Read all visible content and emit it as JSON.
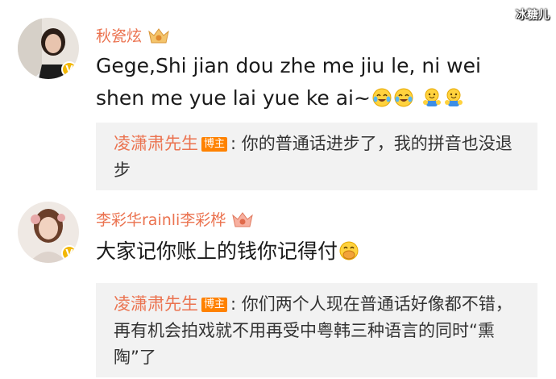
{
  "watermark": "冰糖儿",
  "comments": [
    {
      "username": "秋瓷炫",
      "text": "Gege,Shi jian dou zhe me jiu le, ni wei shen me yue lai yue ke ai~",
      "emojis": [
        "laugh-cry-emoji",
        "laugh-cry-emoji",
        "hug-emoji",
        "hug-emoji"
      ],
      "avatar_badge": "V",
      "reply": {
        "name": "凌潇肃先生",
        "badge": "博主",
        "text": "你的普通话进步了，我的拼音也没退步"
      }
    },
    {
      "username": "李彩华rainli李彩桦",
      "text": "大家记你账上的钱你记得付",
      "emojis": [
        "cover-mouth-laugh-emoji"
      ],
      "avatar_badge": "V",
      "reply": {
        "name": "凌潇肃先生",
        "badge": "博主",
        "text": "你们两个人现在普通话好像都不错，再有机会拍戏就不用再受中粤韩三种语言的同时“熏陶”了"
      }
    }
  ],
  "colors": {
    "username": "#eb7350",
    "reply_background": "#f2f2f2",
    "bozhu_badge": "#ff8200",
    "avatar_badge": "#f2b705"
  }
}
